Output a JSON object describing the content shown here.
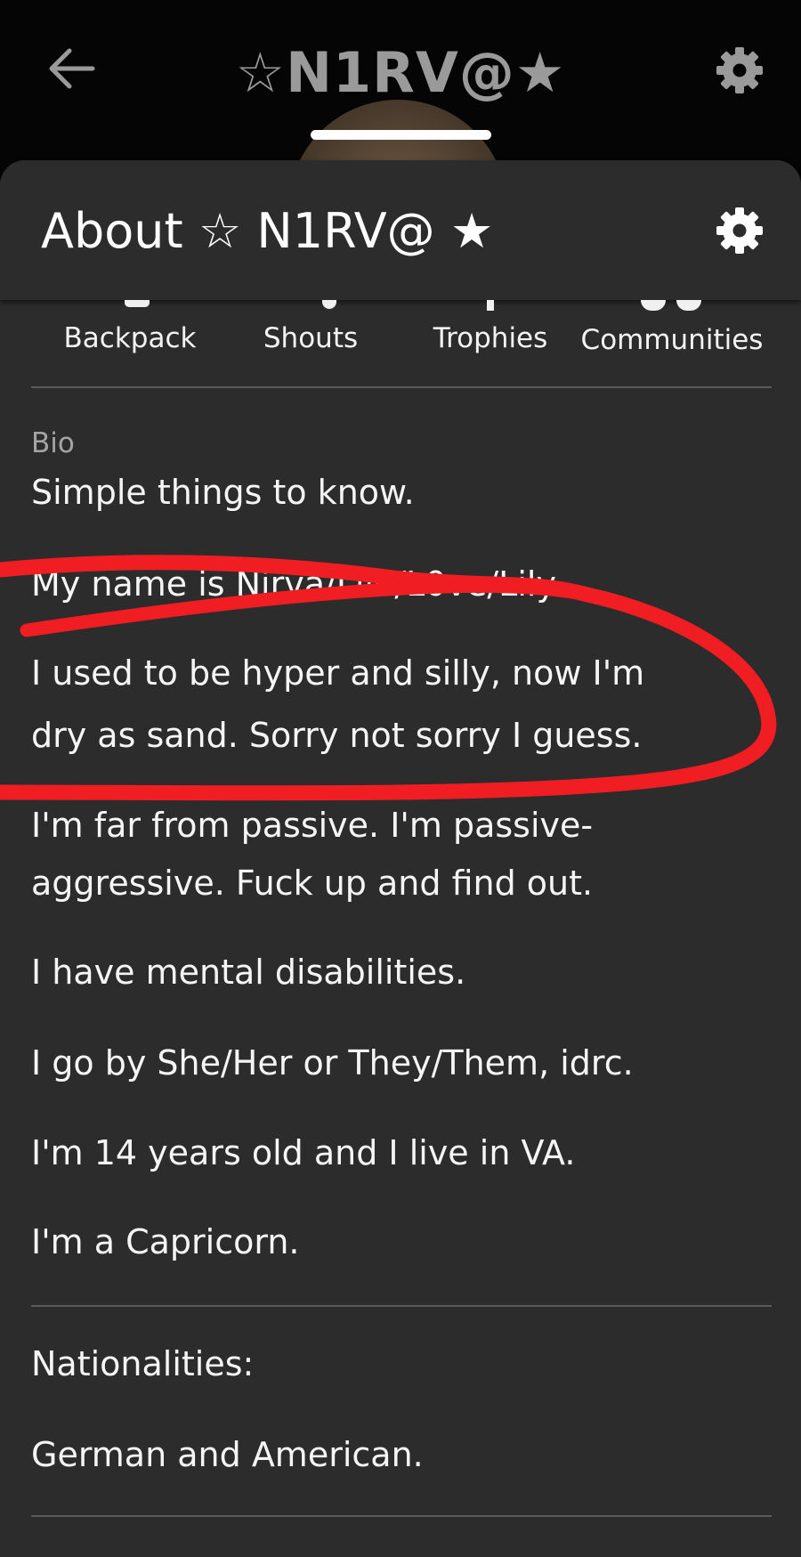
{
  "header": {
    "title": "☆N1RV@★",
    "back_icon": "back-arrow-icon",
    "settings_icon": "gear-icon"
  },
  "about": {
    "title": "About ☆ N1RV@ ★",
    "settings_icon": "gear-icon"
  },
  "tabs": [
    {
      "label": "Backpack"
    },
    {
      "label": "Shouts"
    },
    {
      "label": "Trophies"
    },
    {
      "label": "Communities"
    }
  ],
  "bio": {
    "label": "Bio",
    "lines": [
      "Simple things to know.",
      "My name is Nirva/Lilo/L0ve/Lily.",
      "I used to be hyper and silly, now I'm",
      "dry as sand. Sorry not sorry I guess.",
      "I'm far from passive. I'm passive-",
      "aggressive. Fuck up and find out.",
      "I have mental disabilities.",
      "I go by She/Her or They/Them, idrc.",
      "I'm 14 years old and I live in VA.",
      "I'm a Capricorn."
    ]
  },
  "nationalities": {
    "heading": "Nationalities:",
    "value": "German and American."
  },
  "colors": {
    "background": "#2b2c2b",
    "topbar": "#050505",
    "annotation_red": "#f01e22"
  }
}
